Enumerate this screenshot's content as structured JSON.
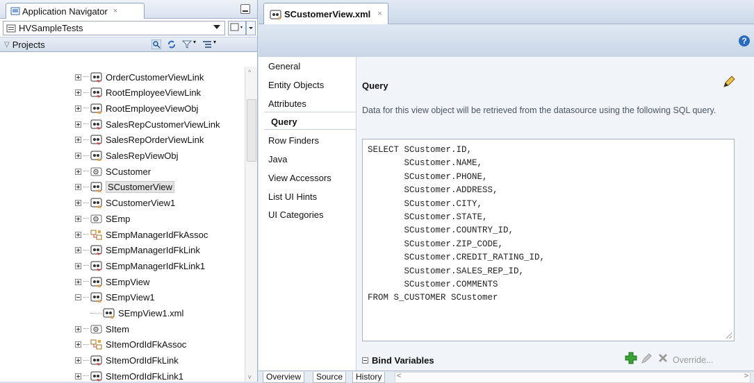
{
  "navigator": {
    "tab_title": "Application Navigator",
    "close": "×",
    "workspace": "HVSampleTests",
    "projects_label": "Projects"
  },
  "tree": [
    {
      "label": "OrderCustomerViewLink",
      "icon": "viewlink-icon",
      "state": "collapsed"
    },
    {
      "label": "RootEmployeeViewLink",
      "icon": "viewlink-icon",
      "state": "collapsed"
    },
    {
      "label": "RootEmployeeViewObj",
      "icon": "viewobject-icon",
      "state": "collapsed"
    },
    {
      "label": "SalesRepCustomerViewLink",
      "icon": "viewlink-icon",
      "state": "collapsed"
    },
    {
      "label": "SalesRepOrderViewLink",
      "icon": "viewlink-icon",
      "state": "collapsed"
    },
    {
      "label": "SalesRepViewObj",
      "icon": "viewobject-icon",
      "state": "collapsed"
    },
    {
      "label": "SCustomer",
      "icon": "entity-icon",
      "state": "collapsed"
    },
    {
      "label": "SCustomerView",
      "icon": "viewobject-icon",
      "state": "collapsed",
      "selected": true
    },
    {
      "label": "SCustomerView1",
      "icon": "viewobject-icon",
      "state": "collapsed"
    },
    {
      "label": "SEmp",
      "icon": "entity-icon",
      "state": "collapsed"
    },
    {
      "label": "SEmpManagerIdFkAssoc",
      "icon": "association-icon",
      "state": "collapsed"
    },
    {
      "label": "SEmpManagerIdFkLink",
      "icon": "viewlink-icon",
      "state": "collapsed"
    },
    {
      "label": "SEmpManagerIdFkLink1",
      "icon": "viewlink-icon",
      "state": "collapsed"
    },
    {
      "label": "SEmpView",
      "icon": "viewobject-icon",
      "state": "collapsed"
    },
    {
      "label": "SEmpView1",
      "icon": "viewobject-icon",
      "state": "expanded"
    },
    {
      "label": "SEmpView1.xml",
      "icon": "viewobject-icon",
      "state": "leaf"
    },
    {
      "label": "SItem",
      "icon": "entity-icon",
      "state": "collapsed"
    },
    {
      "label": "SItemOrdIdFkAssoc",
      "icon": "association-icon",
      "state": "collapsed"
    },
    {
      "label": "SItemOrdIdFkLink",
      "icon": "viewlink-icon",
      "state": "collapsed"
    },
    {
      "label": "SItemOrdIdFkLink1",
      "icon": "viewlink-icon",
      "state": "collapsed"
    }
  ],
  "editor": {
    "tab_title": "SCustomerView.xml",
    "close": "×",
    "help": "?"
  },
  "sections": [
    "General",
    "Entity Objects",
    "Attributes",
    "Query",
    "Row Finders",
    "Java",
    "View Accessors",
    "List UI Hints",
    "UI Categories"
  ],
  "selected_section": "Query",
  "query": {
    "heading": "Query",
    "description": "Data for this view object will be retrieved from the datasource using the following SQL query.",
    "sql_lines": [
      "SELECT SCustomer.ID,",
      "       SCustomer.NAME,",
      "       SCustomer.PHONE,",
      "       SCustomer.ADDRESS,",
      "       SCustomer.CITY,",
      "       SCustomer.STATE,",
      "       SCustomer.COUNTRY_ID,",
      "       SCustomer.ZIP_CODE,",
      "       SCustomer.CREDIT_RATING_ID,",
      "       SCustomer.SALES_REP_ID,",
      "       SCustomer.COMMENTS",
      "FROM S_CUSTOMER SCustomer"
    ]
  },
  "bind_variables": {
    "label": "Bind Variables",
    "override": "Override..."
  },
  "bottom_tabs": [
    "Overview",
    "Source",
    "History"
  ],
  "colors": {
    "accent": "#2a6ac0",
    "selected_row": "#e4e4e4",
    "add_green": "#3aa335"
  }
}
